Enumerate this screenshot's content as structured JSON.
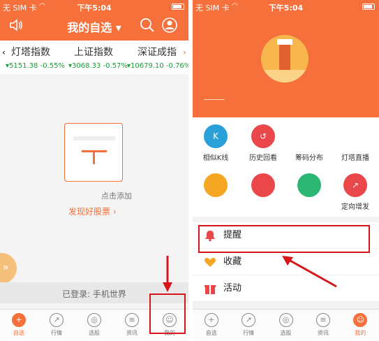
{
  "left": {
    "status": {
      "carrier": "无 SIM 卡",
      "time": "下午5:04"
    },
    "header": {
      "title": "我的自选",
      "dropdown": "▾",
      "speaker_icon": "speaker-icon",
      "search_icon": "search-icon",
      "user_icon": "user-icon"
    },
    "quotes": [
      {
        "name": "灯塔指数",
        "value": "▾5151.38 -0.55%"
      },
      {
        "name": "上证指数",
        "value": "▾3068.33 -0.57%"
      },
      {
        "name": "深证成指",
        "value": "▾10679.10 -0.76%"
      }
    ],
    "arrows": {
      "left": "‹",
      "right": "›"
    },
    "empty": {
      "hint": "点击添加",
      "discover": "发现好股票 ›"
    },
    "floating": "»",
    "logged_in": "已登录: 手机世界",
    "tabs": [
      {
        "label": "自选",
        "icon": "+",
        "active": true
      },
      {
        "label": "行情",
        "icon": "↗",
        "active": false
      },
      {
        "label": "选股",
        "icon": "◎",
        "active": false
      },
      {
        "label": "资讯",
        "icon": "≡",
        "active": false
      },
      {
        "label": "我的",
        "icon": "☺",
        "active": false
      }
    ]
  },
  "right": {
    "status": {
      "carrier": "无 SIM 卡",
      "time": "下午5:04"
    },
    "grid": [
      {
        "label": "相似K线",
        "icon": "K",
        "color": "#2aa0d8"
      },
      {
        "label": "历史回看",
        "icon": "↺",
        "color": "#e9474a"
      },
      {
        "label": "筹码分布",
        "icon": "",
        "color": "#ffffff"
      },
      {
        "label": "灯塔直播",
        "icon": "",
        "color": "#ffffff"
      },
      {
        "label": "",
        "icon": "",
        "color": "#f5a623"
      },
      {
        "label": "",
        "icon": "",
        "color": "#e9474a"
      },
      {
        "label": "",
        "icon": "",
        "color": "#2bb673"
      },
      {
        "label": "定向增发",
        "icon": "↗",
        "color": "#e9474a"
      }
    ],
    "menu": [
      {
        "label": "提醒",
        "icon": "bell-icon",
        "color": "#e9474a"
      },
      {
        "label": "收藏",
        "icon": "heart-icon",
        "color": "#f5a623"
      },
      {
        "label": "活动",
        "icon": "gift-icon",
        "color": "#e9474a"
      }
    ],
    "tabs": [
      {
        "label": "自选",
        "icon": "+",
        "active": false
      },
      {
        "label": "行情",
        "icon": "↗",
        "active": false
      },
      {
        "label": "选股",
        "icon": "◎",
        "active": false
      },
      {
        "label": "资讯",
        "icon": "≡",
        "active": false
      },
      {
        "label": "我的",
        "icon": "☺",
        "active": true
      }
    ]
  }
}
